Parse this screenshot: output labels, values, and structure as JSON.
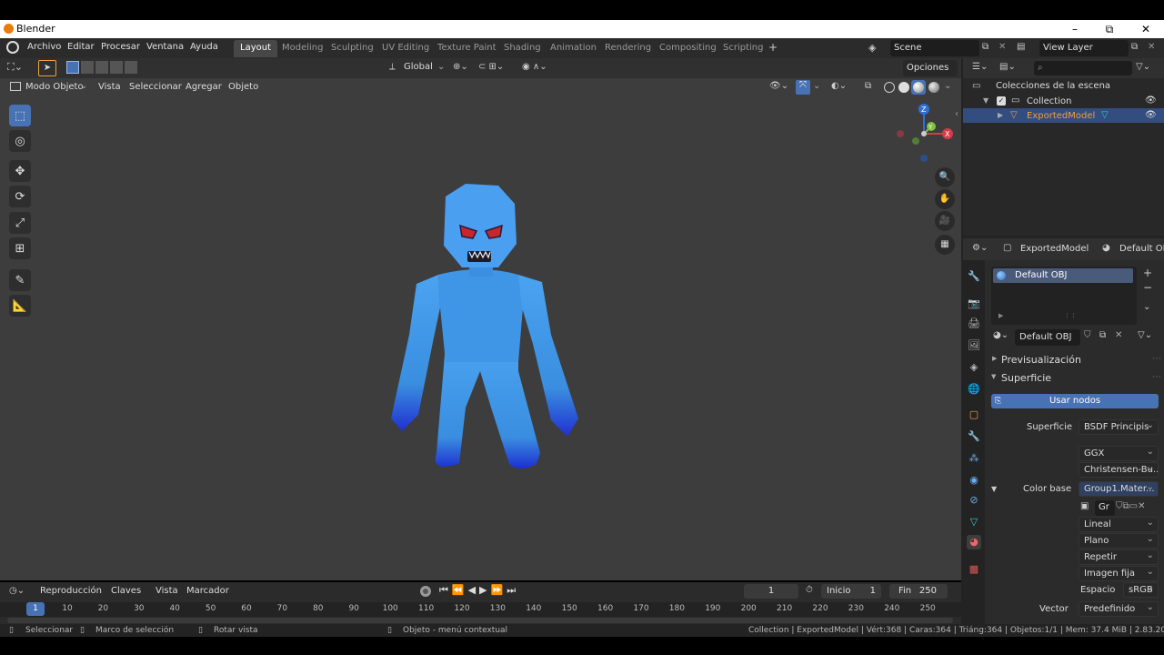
{
  "window": {
    "title": "Blender",
    "min": "–",
    "max": "⧉",
    "close": "✕"
  },
  "menu": [
    "Archivo",
    "Editar",
    "Procesar",
    "Ventana",
    "Ayuda"
  ],
  "workspaces": [
    "Layout",
    "Modeling",
    "Sculpting",
    "UV Editing",
    "Texture Paint",
    "Shading",
    "Animation",
    "Rendering",
    "Compositing",
    "Scripting"
  ],
  "workspace_add": "+",
  "scene": {
    "name": "Scene",
    "view_layer": "View Layer"
  },
  "viewport": {
    "orientation": "Global",
    "options": "Opciones",
    "mode": "Modo Objeto",
    "menus": [
      "Vista",
      "Seleccionar",
      "Agregar",
      "Objeto"
    ],
    "gizmo": {
      "z": "Z",
      "y": "Y",
      "x": "X"
    }
  },
  "outliner": {
    "search_placeholder": "",
    "root": "Colecciones de la escena",
    "items": [
      {
        "label": "Collection",
        "selected": false
      },
      {
        "label": "ExportedModel",
        "selected": true
      }
    ]
  },
  "properties": {
    "object_name": "ExportedModel",
    "material_name_header": "Default OBJ",
    "slot": "Default OBJ",
    "material_field": "Default OBJ",
    "panel_preview": "Previsualización",
    "panel_surface": "Superficie",
    "use_nodes": "Usar nodos",
    "surface_label": "Superficie",
    "surface_value": "BSDF Principis",
    "distribution": "GGX",
    "subsurface": "Christensen-Bu...",
    "base_color_label": "Color base",
    "base_color_value": "Group1.Mater...",
    "image_field": "Gr",
    "interp": "Lineal",
    "projection": "Plano",
    "extension": "Repetir",
    "source": "Imagen fija",
    "space_label": "Espacio",
    "space_value": "sRGB",
    "vector_label": "Vector",
    "vector_value": "Predefinido"
  },
  "timeline": {
    "menus": [
      "Reproducción",
      "Claves",
      "Vista",
      "Marcador"
    ],
    "current_frame": "1",
    "start_label": "Inicio",
    "start": "1",
    "end_label": "Fin",
    "end": "250",
    "ticks": [
      "1",
      "10",
      "20",
      "30",
      "40",
      "50",
      "60",
      "70",
      "80",
      "90",
      "100",
      "110",
      "120",
      "130",
      "140",
      "150",
      "160",
      "170",
      "180",
      "190",
      "200",
      "210",
      "220",
      "230",
      "240",
      "250"
    ]
  },
  "status": {
    "select": "Seleccionar",
    "box": "Marco de selección",
    "rotate": "Rotar vista",
    "context": "Objeto - menú contextual",
    "stats": "Collection | ExportedModel | Vért:368 | Caras:364 | Triáng:364 | Objetos:1/1 | Mem: 37.4 MiB | 2.83.20"
  },
  "colors": {
    "accent": "#4772b3",
    "model": "#3a8ee0",
    "eyes": "#c8262a"
  }
}
